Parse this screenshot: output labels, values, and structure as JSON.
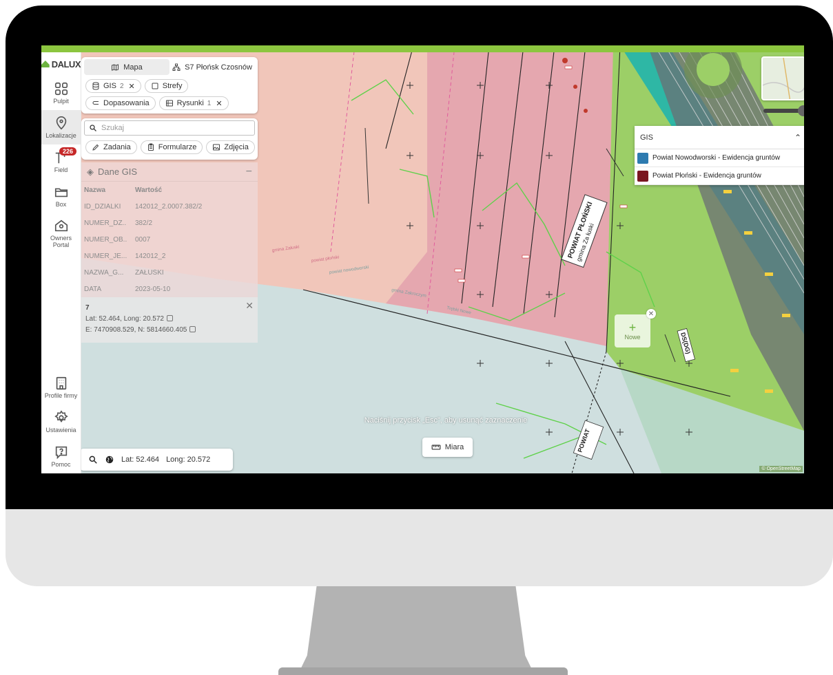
{
  "app": {
    "logo_text": "DALUX"
  },
  "rail": {
    "items": [
      {
        "label": "Pulpit",
        "icon": "grid-icon"
      },
      {
        "label": "Lokalizacje",
        "icon": "location-pin-icon"
      },
      {
        "label": "Field",
        "icon": "crane-icon",
        "badge": "226"
      },
      {
        "label": "Box",
        "icon": "folder-icon"
      },
      {
        "label": "Owners Portal",
        "icon": "house-icon"
      }
    ],
    "bottom_items": [
      {
        "label": "Profile firmy",
        "icon": "building-icon"
      },
      {
        "label": "Ustawienia",
        "icon": "gear-icon"
      },
      {
        "label": "Pomoc",
        "icon": "help-icon"
      }
    ]
  },
  "view_panel": {
    "tabs": [
      {
        "label": "Mapa",
        "icon": "map-icon",
        "active": true
      },
      {
        "label": "S7 Płońsk Czosnów",
        "icon": "hierarchy-icon",
        "active": false
      }
    ],
    "chips": [
      {
        "label": "GIS",
        "count": "2",
        "icon": "database-icon",
        "closable": true
      },
      {
        "label": "Strefy",
        "icon": "square-icon",
        "closable": false
      },
      {
        "label": "Dopasowania",
        "icon": "align-icon",
        "closable": false
      },
      {
        "label": "Rysunki",
        "count": "1",
        "icon": "drawing-icon",
        "closable": true
      }
    ]
  },
  "search": {
    "placeholder": "Szukaj",
    "chips": [
      {
        "label": "Zadania",
        "icon": "pencil-icon"
      },
      {
        "label": "Formularze",
        "icon": "clipboard-icon"
      },
      {
        "label": "Zdjęcia",
        "icon": "image-icon"
      }
    ]
  },
  "gis_data": {
    "title": "Dane GIS",
    "header": {
      "key": "Nazwa",
      "value": "Wartość"
    },
    "rows": [
      {
        "key": "ID_DZIALKI",
        "value": "142012_2.0007.382/2"
      },
      {
        "key": "NUMER_DZ...",
        "value": "382/2"
      },
      {
        "key": "NUMER_OB...",
        "value": "0007"
      },
      {
        "key": "NUMER_JE...",
        "value": "142012_2"
      },
      {
        "key": "NAZWA_G...",
        "value": "ZAŁUSKI"
      },
      {
        "key": "DATA",
        "value": "2023-05-10"
      }
    ]
  },
  "selection": {
    "id": "7",
    "latlong": "Lat: 52.464, Long: 20.572",
    "en": "E: 7470908.529, N: 5814660.405"
  },
  "coord_bar": {
    "lat": "Lat: 52.464",
    "long": "Long: 20.572"
  },
  "measure": {
    "label": "Miara"
  },
  "esc_hint": "Naciśnij przycisk „Esc”, aby usunąć zaznaczenie",
  "gis_popup": {
    "title": "GIS",
    "layers": [
      {
        "label": "Powiat Nowodworski - Ewidencja gruntów",
        "color": "#2e7bb0"
      },
      {
        "label": "Powiat Płoński - Ewidencja gruntów",
        "color": "#7a1620"
      }
    ]
  },
  "new_marker": {
    "label": "Nowe"
  },
  "map_labels": {
    "district": "POWIAT PŁOŃSKI",
    "commune": "gmina Za łuski",
    "road_code": "DS(DG)",
    "street_1": "gmina Załuski",
    "street_2": "powiat płoński",
    "street_3": "powiat nowodworski",
    "street_4": "gmina Zakroczym",
    "street_5": "Trębki Nowe",
    "district_2": "POWIAT"
  },
  "attribution": "© OpenStreetMap",
  "colors": {
    "accent": "#8cc63f",
    "badge": "#c62828"
  }
}
